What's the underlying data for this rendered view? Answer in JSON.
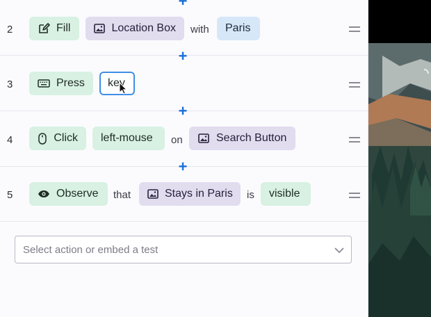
{
  "steps": [
    {
      "num": "2",
      "action": "Fill",
      "action_icon": "edit-icon",
      "target": "Location Box",
      "connector": "with",
      "value": "Paris"
    },
    {
      "num": "3",
      "action": "Press",
      "action_icon": "keyboard-icon",
      "input_value": "key"
    },
    {
      "num": "4",
      "action": "Click",
      "action_icon": "mouse-icon",
      "button": "left-mouse",
      "connector": "on",
      "target": "Search Button"
    },
    {
      "num": "5",
      "action": "Observe",
      "action_icon": "eye-icon",
      "connector": "that",
      "target": "Stays in Paris",
      "connector2": "is",
      "state": "visible"
    }
  ],
  "add_step_symbol": "+",
  "select": {
    "placeholder": "Select action or embed a test"
  },
  "colors": {
    "action_chip": "#d8f1e2",
    "element_chip": "#e2dcef",
    "value_chip": "#d6e7f8",
    "accent": "#1d6fd6"
  }
}
